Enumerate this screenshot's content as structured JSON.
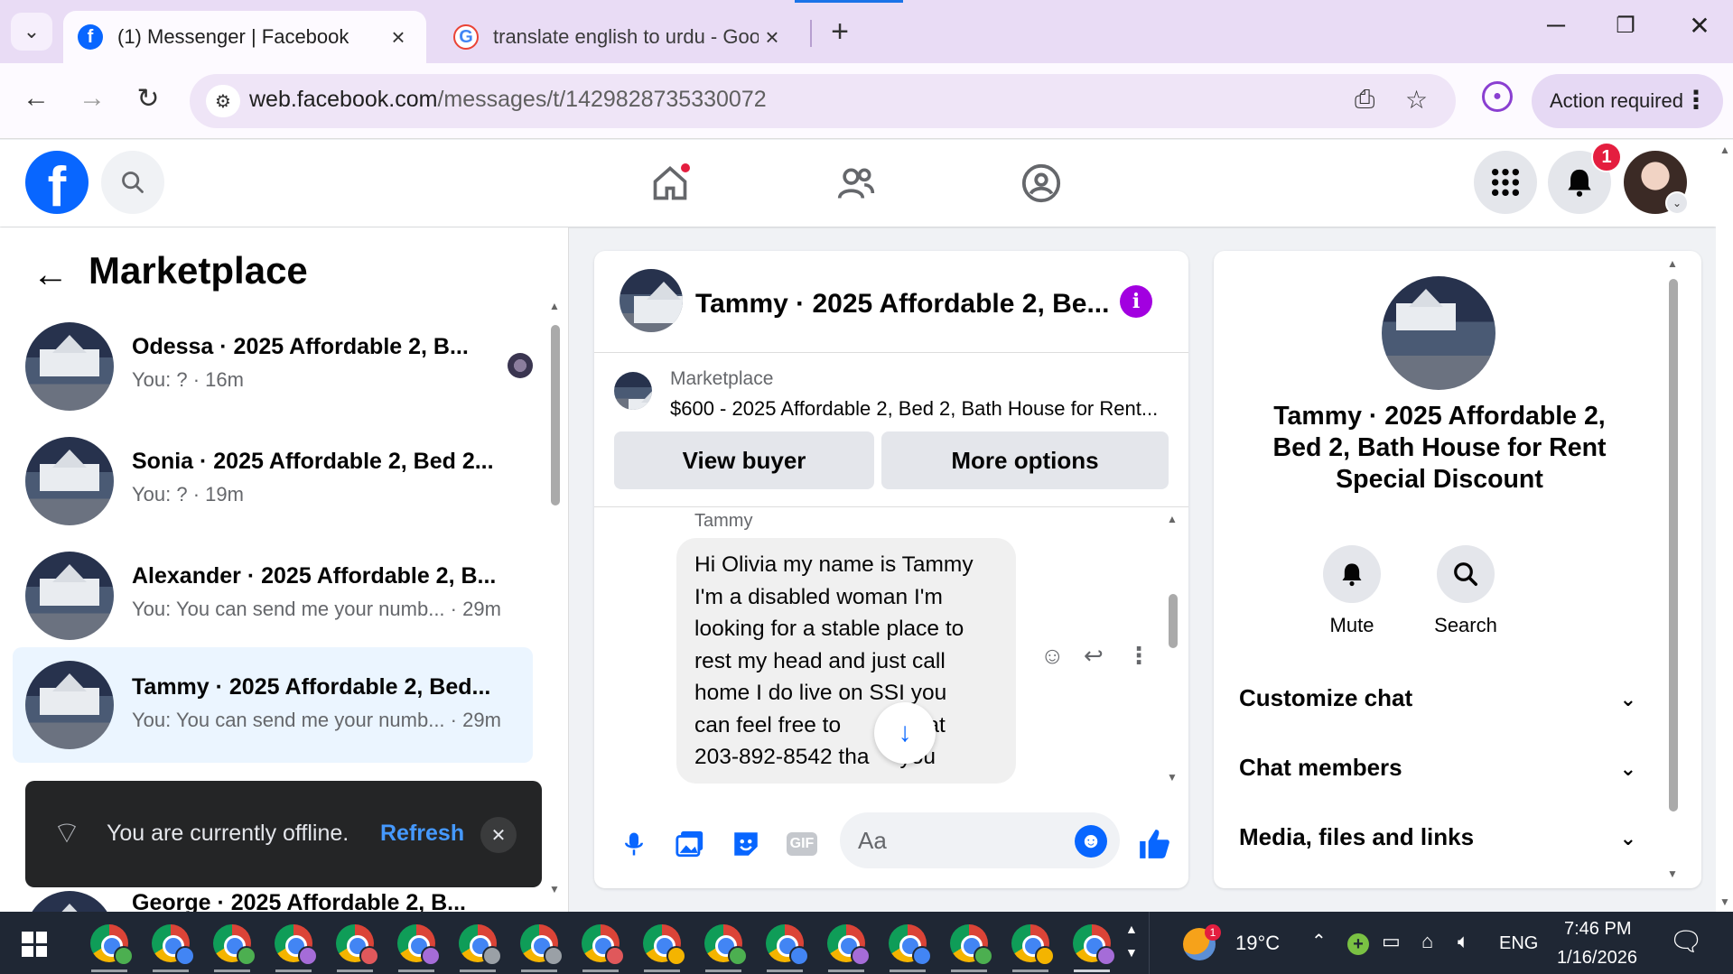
{
  "browser": {
    "tabs": [
      {
        "title": "(1) Messenger | Facebook",
        "active": true,
        "icon": "facebook-icon"
      },
      {
        "title": "translate english to urdu - Goog",
        "active": false,
        "icon": "google-icon"
      }
    ],
    "url_domain": "web.facebook.com",
    "url_path": "/messages/t/1429828735330072",
    "action_required_label": "Action required"
  },
  "fb_header": {
    "notification_count": "1",
    "nav_icons": [
      "home-icon",
      "friends-icon",
      "groups-icon"
    ]
  },
  "sidebar": {
    "title": "Marketplace",
    "conversations": [
      {
        "name": "Odessa · 2025 Affordable 2, B...",
        "preview": "You: ? · 16m",
        "selected": false,
        "seen": true
      },
      {
        "name": "Sonia · 2025 Affordable 2, Bed 2...",
        "preview": "You: ? · 19m",
        "selected": false,
        "seen": false
      },
      {
        "name": "Alexander · 2025 Affordable 2, B...",
        "preview": "You: You can send me your numb... · 29m",
        "selected": false,
        "seen": false
      },
      {
        "name": "Tammy · 2025 Affordable 2, Bed...",
        "preview": "You: You can send me your numb... · 29m",
        "selected": true,
        "seen": false
      },
      {
        "name": "George · 2025 Affordable 2, B...",
        "preview": "",
        "selected": false,
        "seen": false
      }
    ]
  },
  "toast": {
    "message": "You are currently offline.",
    "action": "Refresh"
  },
  "chat": {
    "title": "Tammy · 2025 Affordable 2, Be...",
    "listing_source": "Marketplace",
    "listing_title": "$600 - 2025 Affordable 2, Bed 2, Bath House for Rent...",
    "view_buyer_label": "View buyer",
    "more_options_label": "More options",
    "sender": "Tammy",
    "message_lines": [
      "Hi Olivia my name is Tammy",
      "I'm a disabled woman I'm",
      "looking for a stable place to",
      "rest my head and just call",
      "home I do live on SSI you",
      "can feel free to        me at",
      "203-892-8542 tha     you"
    ],
    "input_placeholder": "Aa"
  },
  "details": {
    "title": "Tammy · 2025 Affordable 2, Bed 2, Bath House for Rent Special Discount",
    "mute_label": "Mute",
    "search_label": "Search",
    "sections": [
      "Customize chat",
      "Chat members",
      "Media, files and links"
    ]
  },
  "taskbar": {
    "weather_temp": "19°C",
    "weather_badge": "1",
    "language": "ENG",
    "time": "7:46 PM",
    "date": "1/16/2026",
    "chrome_profile_colors": [
      "#4caf50",
      "#4285f4",
      "#4caf50",
      "#a56cd8",
      "#e0585b",
      "#a56cd8",
      "#9aa0a6",
      "#9aa0a6",
      "#e0585b",
      "#f4b400",
      "#4caf50",
      "#4285f4",
      "#a56cd8",
      "#4285f4",
      "#4caf50",
      "#f4b400",
      "#a56cd8"
    ]
  }
}
